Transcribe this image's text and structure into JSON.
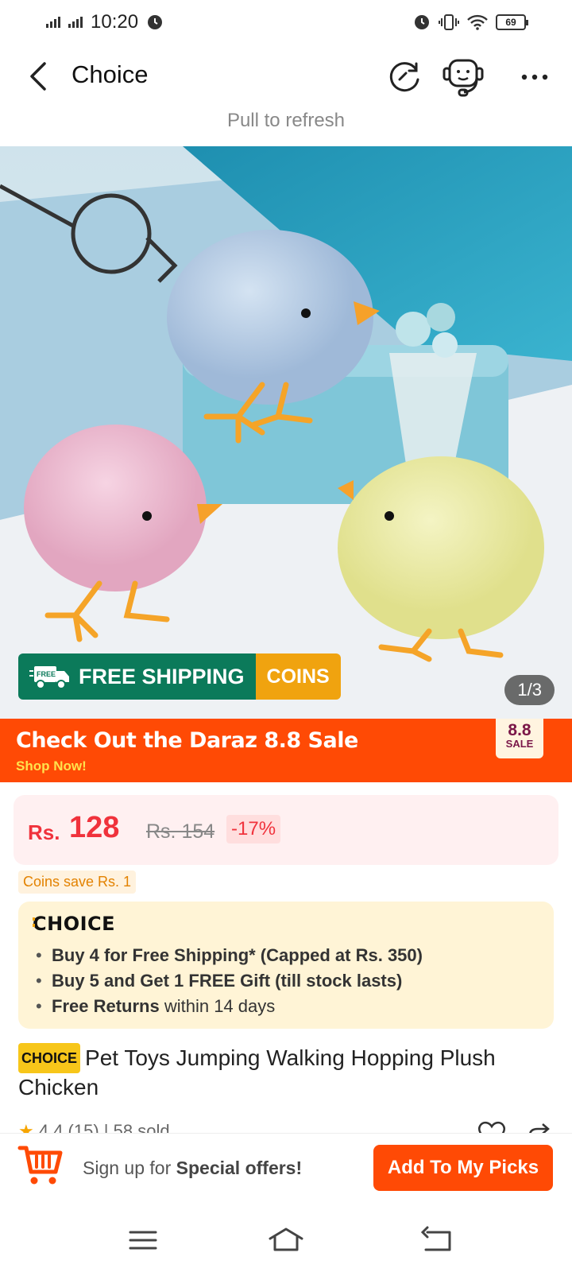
{
  "status": {
    "time": "10:20",
    "battery": "69"
  },
  "header": {
    "title": "Choice"
  },
  "pull_text": "Pull to refresh",
  "hero": {
    "free_tag": "FREE",
    "free_shipping": "FREE SHIPPING",
    "coins": "COINS",
    "counter": "1/3"
  },
  "sale_banner": {
    "title": "Check Out the  Daraz 8.8 Sale",
    "subtitle": "Shop Now!",
    "tag_number": "8.8",
    "tag_label": "SALE"
  },
  "price": {
    "currency": "Rs.",
    "value": "128",
    "original": "Rs. 154",
    "discount": "-17%"
  },
  "coins_save": "Coins save Rs. 1",
  "choice": {
    "logo": "CHOICE",
    "items": [
      {
        "bold": "Buy 4 for  Free Shipping* (Capped at Rs. 350)",
        "rest": ""
      },
      {
        "bold": "Buy 5 and Get 1 FREE Gift (till stock lasts)",
        "rest": ""
      },
      {
        "bold": "Free Returns",
        "rest": " within 14 days"
      }
    ]
  },
  "product": {
    "chip": "CHOICE",
    "title": "Pet Toys Jumping Walking Hopping Plush Chicken",
    "rating": "4.4 (15)",
    "sold": "58 sold"
  },
  "bottom": {
    "signup_prefix": "Sign up for ",
    "signup_bold": "Special offers!",
    "button": "Add To My Picks"
  },
  "colors": {
    "accent": "#ff4a05",
    "price": "#f0323c",
    "ship_green": "#0b7a5a",
    "coins_orange": "#f0a30f"
  }
}
